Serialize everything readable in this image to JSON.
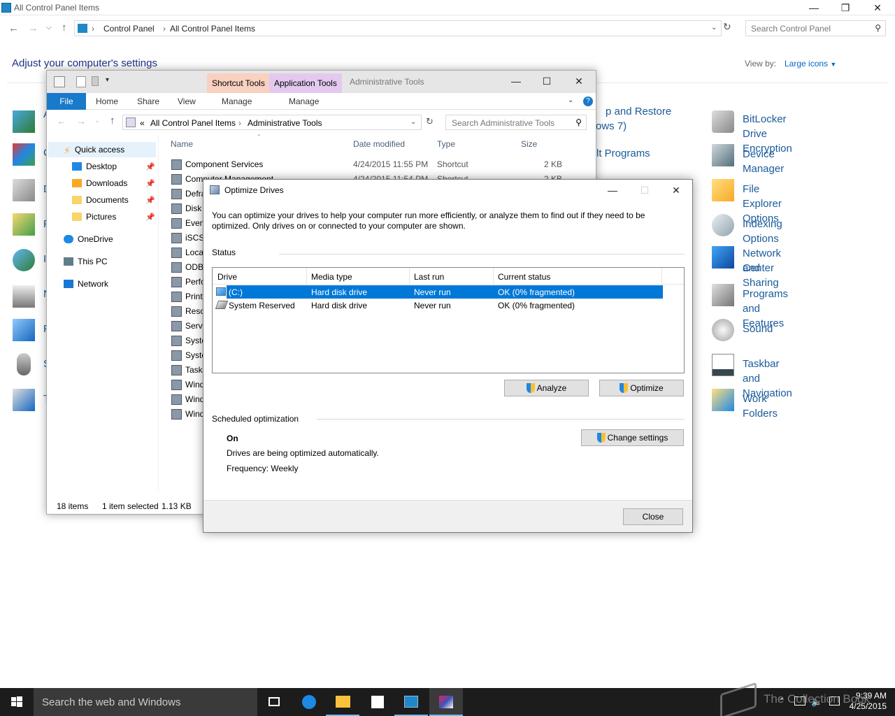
{
  "control_panel": {
    "window_title": "All Control Panel Items",
    "breadcrumb": [
      "Control Panel",
      "All Control Panel Items"
    ],
    "search_placeholder": "Search Control Panel",
    "heading": "Adjust your computer's settings",
    "view_by_label": "View by:",
    "view_by_value": "Large icons",
    "partial_items": [
      "p and Restore",
      "ows 7)",
      "lt Programs"
    ],
    "right_items": [
      {
        "label": "BitLocker Drive Encryption",
        "icon": "bitlocker-icon"
      },
      {
        "label": "Device Manager",
        "icon": "device-manager-icon"
      },
      {
        "label": "File Explorer Options",
        "icon": "folder-options-icon"
      },
      {
        "label": "Indexing Options",
        "icon": "indexing-icon"
      },
      {
        "label": "Network and Sharing",
        "label2": "Center",
        "icon": "network-icon"
      },
      {
        "label": "Programs and Features",
        "icon": "programs-icon"
      },
      {
        "label": "Sound",
        "icon": "sound-icon"
      },
      {
        "label": "Taskbar and Navigation",
        "icon": "taskbar-icon"
      },
      {
        "label": "Work Folders",
        "icon": "work-folders-icon"
      }
    ],
    "left_partial_letters": [
      "A",
      "C",
      "D",
      "F",
      "I",
      "N",
      "F",
      "S",
      "T"
    ]
  },
  "explorer": {
    "contextual_tabs": [
      "Shortcut Tools",
      "Application Tools"
    ],
    "window_title": "Administrative Tools",
    "ribbon_tabs": [
      "File",
      "Home",
      "Share",
      "View",
      "Manage",
      "Manage"
    ],
    "breadcrumb_prefix": "«",
    "breadcrumb": [
      "All Control Panel Items",
      "Administrative Tools"
    ],
    "search_placeholder": "Search Administrative Tools",
    "nav": {
      "quick_access": "Quick access",
      "pinned": [
        "Desktop",
        "Downloads",
        "Documents",
        "Pictures"
      ],
      "onedrive": "OneDrive",
      "this_pc": "This PC",
      "network": "Network"
    },
    "columns": {
      "name": "Name",
      "date": "Date modified",
      "type": "Type",
      "size": "Size"
    },
    "files": [
      {
        "name": "Component Services",
        "date": "4/24/2015 11:55 PM",
        "type": "Shortcut",
        "size": "2 KB"
      },
      {
        "name": "Computer Management",
        "date": "4/24/2015 11:54 PM",
        "type": "Shortcut",
        "size": "2 KB"
      },
      {
        "name": "Defra"
      },
      {
        "name": "Disk"
      },
      {
        "name": "Even"
      },
      {
        "name": "iSCSI"
      },
      {
        "name": "Loca"
      },
      {
        "name": "ODB"
      },
      {
        "name": "Perfo"
      },
      {
        "name": "Print"
      },
      {
        "name": "Reso"
      },
      {
        "name": "Servi"
      },
      {
        "name": "Syste"
      },
      {
        "name": "Syste"
      },
      {
        "name": "Task"
      },
      {
        "name": "Wind"
      },
      {
        "name": "Wind"
      },
      {
        "name": "Wind"
      }
    ],
    "status_items": "18 items",
    "status_selected": "1 item selected",
    "status_size": "1.13 KB"
  },
  "dialog": {
    "title": "Optimize Drives",
    "description": "You can optimize your drives to help your computer run more efficiently, or analyze them to find out if they need to be optimized. Only drives on or connected to your computer are shown.",
    "status_label": "Status",
    "columns": {
      "drive": "Drive",
      "media": "Media type",
      "last_run": "Last run",
      "status": "Current status"
    },
    "drives": [
      {
        "drive": "(C:)",
        "media": "Hard disk drive",
        "last_run": "Never run",
        "status": "OK (0% fragmented)",
        "selected": true
      },
      {
        "drive": "System Reserved",
        "media": "Hard disk drive",
        "last_run": "Never run",
        "status": "OK (0% fragmented)",
        "selected": false
      }
    ],
    "analyze_button": "Analyze",
    "optimize_button": "Optimize",
    "scheduled_label": "Scheduled optimization",
    "scheduled_state": "On",
    "scheduled_desc": "Drives are being optimized automatically.",
    "frequency": "Frequency: Weekly",
    "change_settings_button": "Change settings",
    "close_button": "Close"
  },
  "taskbar": {
    "search_placeholder": "Search the web and Windows",
    "time": "9:39 AM",
    "date": "4/25/2015",
    "watermark": "The Collection Book"
  },
  "colors": {
    "accent": "#0078d7",
    "link": "#1a5b9a",
    "shortcut_tools_tab": "#f8d1c0",
    "application_tools_tab": "#e3c9f0",
    "taskbar": "#1c1c1c"
  }
}
